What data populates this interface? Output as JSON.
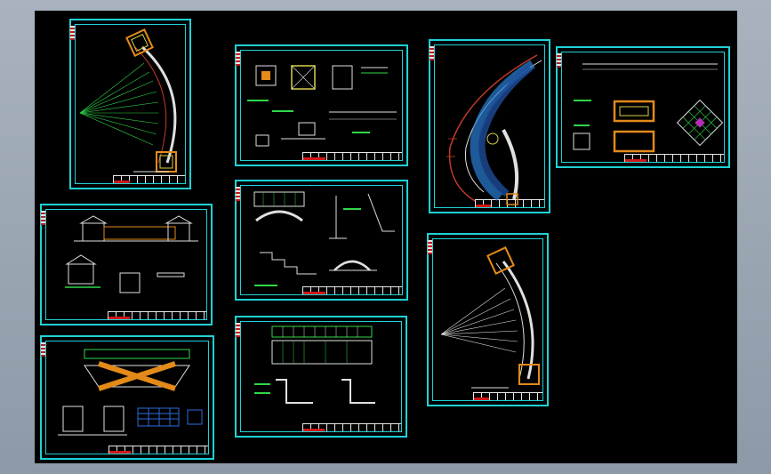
{
  "viewer": {
    "background_color": "#000000",
    "frame_color": "#1fd2d6"
  },
  "sheets": [
    {
      "id": "curved-corridor-plan-1"
    },
    {
      "id": "pavilion-details"
    },
    {
      "id": "curved-path-overview"
    },
    {
      "id": "paving-details"
    },
    {
      "id": "pavilion-elevation"
    },
    {
      "id": "arch-bridge-section"
    },
    {
      "id": "curved-corridor-plan-2"
    },
    {
      "id": "bridge-elevation"
    },
    {
      "id": "stair-details"
    }
  ]
}
